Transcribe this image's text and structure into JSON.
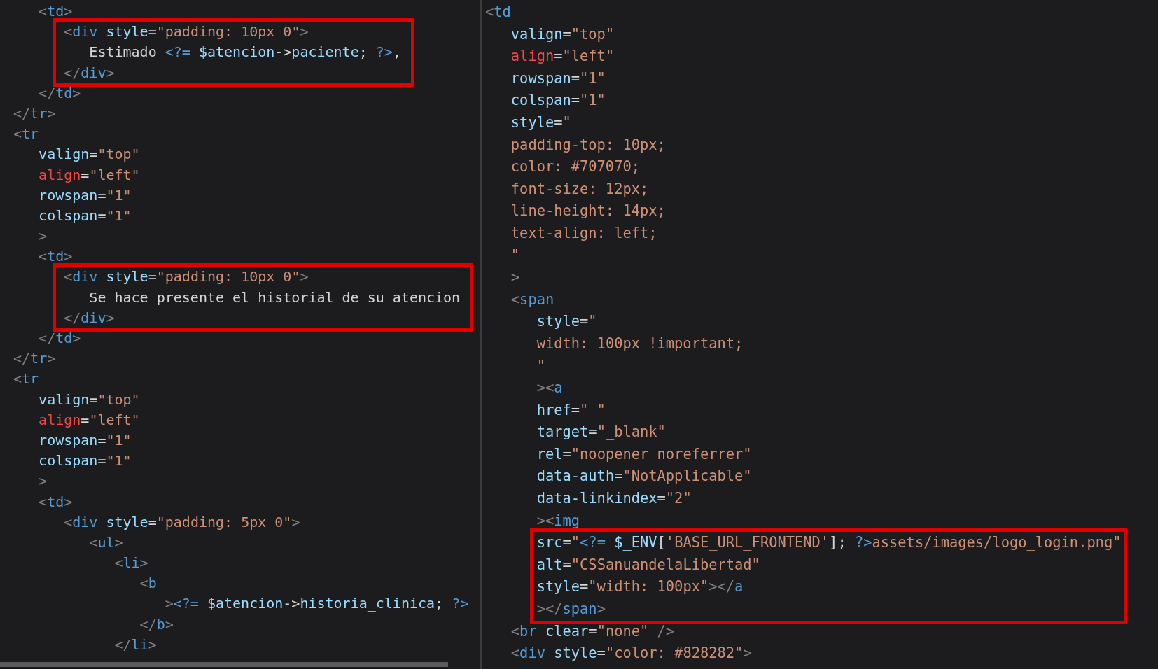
{
  "panes": [
    {
      "blocks": [
        {
          "highlighted": false,
          "lines": [
            {
              "tokens": [
                {
                  "kind": "punct",
                  "text": "   <"
                },
                {
                  "kind": "tag",
                  "text": "td"
                },
                {
                  "kind": "punct",
                  "text": ">"
                }
              ]
            }
          ]
        },
        {
          "highlighted": true,
          "lines": [
            {
              "tokens": [
                {
                  "kind": "punct",
                  "text": "      <"
                },
                {
                  "kind": "tag",
                  "text": "div "
                },
                {
                  "kind": "attr",
                  "text": "style"
                },
                {
                  "kind": "text",
                  "text": "="
                },
                {
                  "kind": "string",
                  "text": "\"padding: 10px 0\""
                },
                {
                  "kind": "punct",
                  "text": ">"
                }
              ]
            },
            {
              "tokens": [
                {
                  "kind": "text",
                  "text": "         Estimado "
                },
                {
                  "kind": "php",
                  "text": "<?= "
                },
                {
                  "kind": "var",
                  "text": "$atencion"
                },
                {
                  "kind": "text",
                  "text": "->"
                },
                {
                  "kind": "var",
                  "text": "paciente"
                },
                {
                  "kind": "text",
                  "text": "; "
                },
                {
                  "kind": "php",
                  "text": "?>"
                },
                {
                  "kind": "text",
                  "text": ","
                }
              ]
            },
            {
              "tokens": [
                {
                  "kind": "punct",
                  "text": "      </"
                },
                {
                  "kind": "tag",
                  "text": "div"
                },
                {
                  "kind": "punct",
                  "text": ">"
                }
              ]
            }
          ]
        },
        {
          "highlighted": false,
          "lines": [
            {
              "tokens": [
                {
                  "kind": "punct",
                  "text": "   </"
                },
                {
                  "kind": "tag",
                  "text": "td"
                },
                {
                  "kind": "punct",
                  "text": ">"
                }
              ]
            },
            {
              "tokens": [
                {
                  "kind": "punct",
                  "text": "</"
                },
                {
                  "kind": "tag",
                  "text": "tr"
                },
                {
                  "kind": "punct",
                  "text": ">"
                }
              ]
            },
            {
              "tokens": [
                {
                  "kind": "punct",
                  "text": "<"
                },
                {
                  "kind": "tag",
                  "text": "tr"
                }
              ]
            },
            {
              "tokens": [
                {
                  "kind": "attr",
                  "text": "   valign"
                },
                {
                  "kind": "text",
                  "text": "="
                },
                {
                  "kind": "string",
                  "text": "\"top\""
                }
              ]
            },
            {
              "tokens": [
                {
                  "kind": "attr_warn",
                  "text": "   align"
                },
                {
                  "kind": "text",
                  "text": "="
                },
                {
                  "kind": "string",
                  "text": "\"left\""
                }
              ]
            },
            {
              "tokens": [
                {
                  "kind": "attr",
                  "text": "   rowspan"
                },
                {
                  "kind": "text",
                  "text": "="
                },
                {
                  "kind": "string",
                  "text": "\"1\""
                }
              ]
            },
            {
              "tokens": [
                {
                  "kind": "attr",
                  "text": "   colspan"
                },
                {
                  "kind": "text",
                  "text": "="
                },
                {
                  "kind": "string",
                  "text": "\"1\""
                }
              ]
            },
            {
              "tokens": [
                {
                  "kind": "punct",
                  "text": "   >"
                }
              ]
            },
            {
              "tokens": [
                {
                  "kind": "punct",
                  "text": "   <"
                },
                {
                  "kind": "tag",
                  "text": "td"
                },
                {
                  "kind": "punct",
                  "text": ">"
                }
              ]
            }
          ]
        },
        {
          "highlighted": true,
          "lines": [
            {
              "tokens": [
                {
                  "kind": "punct",
                  "text": "      <"
                },
                {
                  "kind": "tag",
                  "text": "div "
                },
                {
                  "kind": "attr",
                  "text": "style"
                },
                {
                  "kind": "text",
                  "text": "="
                },
                {
                  "kind": "string",
                  "text": "\"padding: 10px 0\""
                },
                {
                  "kind": "punct",
                  "text": ">"
                }
              ]
            },
            {
              "tokens": [
                {
                  "kind": "text",
                  "text": "         Se hace presente el historial de su atencion"
                }
              ]
            },
            {
              "tokens": [
                {
                  "kind": "punct",
                  "text": "      </"
                },
                {
                  "kind": "tag",
                  "text": "div"
                },
                {
                  "kind": "punct",
                  "text": ">"
                }
              ]
            }
          ]
        },
        {
          "highlighted": false,
          "lines": [
            {
              "tokens": [
                {
                  "kind": "punct",
                  "text": "   </"
                },
                {
                  "kind": "tag",
                  "text": "td"
                },
                {
                  "kind": "punct",
                  "text": ">"
                }
              ]
            },
            {
              "tokens": [
                {
                  "kind": "punct",
                  "text": "</"
                },
                {
                  "kind": "tag",
                  "text": "tr"
                },
                {
                  "kind": "punct",
                  "text": ">"
                }
              ]
            },
            {
              "tokens": [
                {
                  "kind": "punct",
                  "text": "<"
                },
                {
                  "kind": "tag",
                  "text": "tr"
                }
              ]
            },
            {
              "tokens": [
                {
                  "kind": "attr",
                  "text": "   valign"
                },
                {
                  "kind": "text",
                  "text": "="
                },
                {
                  "kind": "string",
                  "text": "\"top\""
                }
              ]
            },
            {
              "tokens": [
                {
                  "kind": "attr_warn",
                  "text": "   align"
                },
                {
                  "kind": "text",
                  "text": "="
                },
                {
                  "kind": "string",
                  "text": "\"left\""
                }
              ]
            },
            {
              "tokens": [
                {
                  "kind": "attr",
                  "text": "   rowspan"
                },
                {
                  "kind": "text",
                  "text": "="
                },
                {
                  "kind": "string",
                  "text": "\"1\""
                }
              ]
            },
            {
              "tokens": [
                {
                  "kind": "attr",
                  "text": "   colspan"
                },
                {
                  "kind": "text",
                  "text": "="
                },
                {
                  "kind": "string",
                  "text": "\"1\""
                }
              ]
            },
            {
              "tokens": [
                {
                  "kind": "punct",
                  "text": "   >"
                }
              ]
            },
            {
              "tokens": [
                {
                  "kind": "punct",
                  "text": "   <"
                },
                {
                  "kind": "tag",
                  "text": "td"
                },
                {
                  "kind": "punct",
                  "text": ">"
                }
              ]
            },
            {
              "tokens": [
                {
                  "kind": "punct",
                  "text": "      <"
                },
                {
                  "kind": "tag",
                  "text": "div "
                },
                {
                  "kind": "attr",
                  "text": "style"
                },
                {
                  "kind": "text",
                  "text": "="
                },
                {
                  "kind": "string",
                  "text": "\"padding: 5px 0\""
                },
                {
                  "kind": "punct",
                  "text": ">"
                }
              ]
            },
            {
              "tokens": [
                {
                  "kind": "punct",
                  "text": "         <"
                },
                {
                  "kind": "tag",
                  "text": "ul"
                },
                {
                  "kind": "punct",
                  "text": ">"
                }
              ]
            },
            {
              "tokens": [
                {
                  "kind": "punct",
                  "text": "            <"
                },
                {
                  "kind": "tag",
                  "text": "li"
                },
                {
                  "kind": "punct",
                  "text": ">"
                }
              ]
            },
            {
              "tokens": [
                {
                  "kind": "punct",
                  "text": "               <"
                },
                {
                  "kind": "tag",
                  "text": "b"
                }
              ]
            },
            {
              "tokens": [
                {
                  "kind": "punct",
                  "text": "                  >"
                },
                {
                  "kind": "php",
                  "text": "<?= "
                },
                {
                  "kind": "var",
                  "text": "$atencion"
                },
                {
                  "kind": "text",
                  "text": "->"
                },
                {
                  "kind": "var",
                  "text": "historia_clinica"
                },
                {
                  "kind": "text",
                  "text": "; "
                },
                {
                  "kind": "php",
                  "text": "?>"
                }
              ]
            },
            {
              "tokens": [
                {
                  "kind": "punct",
                  "text": "               </"
                },
                {
                  "kind": "tag",
                  "text": "b"
                },
                {
                  "kind": "punct",
                  "text": ">"
                }
              ]
            },
            {
              "tokens": [
                {
                  "kind": "punct",
                  "text": "            </"
                },
                {
                  "kind": "tag",
                  "text": "li"
                },
                {
                  "kind": "punct",
                  "text": ">"
                }
              ]
            }
          ]
        }
      ]
    },
    {
      "blocks": [
        {
          "highlighted": false,
          "lines": [
            {
              "tokens": [
                {
                  "kind": "punct",
                  "text": "<"
                },
                {
                  "kind": "tag",
                  "text": "td"
                }
              ]
            },
            {
              "tokens": [
                {
                  "kind": "attr",
                  "text": "   valign"
                },
                {
                  "kind": "text",
                  "text": "="
                },
                {
                  "kind": "string",
                  "text": "\"top\""
                }
              ]
            },
            {
              "tokens": [
                {
                  "kind": "attr_warn",
                  "text": "   align"
                },
                {
                  "kind": "text",
                  "text": "="
                },
                {
                  "kind": "string",
                  "text": "\"left\""
                }
              ]
            },
            {
              "tokens": [
                {
                  "kind": "attr",
                  "text": "   rowspan"
                },
                {
                  "kind": "text",
                  "text": "="
                },
                {
                  "kind": "string",
                  "text": "\"1\""
                }
              ]
            },
            {
              "tokens": [
                {
                  "kind": "attr",
                  "text": "   colspan"
                },
                {
                  "kind": "text",
                  "text": "="
                },
                {
                  "kind": "string",
                  "text": "\"1\""
                }
              ]
            },
            {
              "tokens": [
                {
                  "kind": "attr",
                  "text": "   style"
                },
                {
                  "kind": "text",
                  "text": "="
                },
                {
                  "kind": "string",
                  "text": "\""
                }
              ]
            },
            {
              "tokens": [
                {
                  "kind": "string",
                  "text": "   padding-top: 10px;"
                }
              ]
            },
            {
              "tokens": [
                {
                  "kind": "string",
                  "text": "   color: #707070;"
                }
              ]
            },
            {
              "tokens": [
                {
                  "kind": "string",
                  "text": "   font-size: 12px;"
                }
              ]
            },
            {
              "tokens": [
                {
                  "kind": "string",
                  "text": "   line-height: 14px;"
                }
              ]
            },
            {
              "tokens": [
                {
                  "kind": "string",
                  "text": "   text-align: left;"
                }
              ]
            },
            {
              "tokens": [
                {
                  "kind": "string",
                  "text": "   \""
                }
              ]
            },
            {
              "tokens": [
                {
                  "kind": "punct",
                  "text": "   >"
                }
              ]
            },
            {
              "tokens": [
                {
                  "kind": "punct",
                  "text": "   <"
                },
                {
                  "kind": "tag",
                  "text": "span"
                }
              ]
            },
            {
              "tokens": [
                {
                  "kind": "attr",
                  "text": "      style"
                },
                {
                  "kind": "text",
                  "text": "="
                },
                {
                  "kind": "string",
                  "text": "\""
                }
              ]
            },
            {
              "tokens": [
                {
                  "kind": "string",
                  "text": "      width: 100px !important;"
                }
              ]
            },
            {
              "tokens": [
                {
                  "kind": "string",
                  "text": "      \""
                }
              ]
            },
            {
              "tokens": [
                {
                  "kind": "punct",
                  "text": "      ><"
                },
                {
                  "kind": "tag",
                  "text": "a"
                }
              ]
            },
            {
              "tokens": [
                {
                  "kind": "attr",
                  "text": "      href"
                },
                {
                  "kind": "text",
                  "text": "="
                },
                {
                  "kind": "string",
                  "text": "\" \""
                }
              ]
            },
            {
              "tokens": [
                {
                  "kind": "attr",
                  "text": "      target"
                },
                {
                  "kind": "text",
                  "text": "="
                },
                {
                  "kind": "string",
                  "text": "\"_blank\""
                }
              ]
            },
            {
              "tokens": [
                {
                  "kind": "attr",
                  "text": "      rel"
                },
                {
                  "kind": "text",
                  "text": "="
                },
                {
                  "kind": "string",
                  "text": "\"noopener noreferrer\""
                }
              ]
            },
            {
              "tokens": [
                {
                  "kind": "attr",
                  "text": "      data-auth"
                },
                {
                  "kind": "text",
                  "text": "="
                },
                {
                  "kind": "string",
                  "text": "\"NotApplicable\""
                }
              ]
            },
            {
              "tokens": [
                {
                  "kind": "attr",
                  "text": "      data-linkindex"
                },
                {
                  "kind": "text",
                  "text": "="
                },
                {
                  "kind": "string",
                  "text": "\"2\""
                }
              ]
            },
            {
              "tokens": [
                {
                  "kind": "punct",
                  "text": "      ><"
                },
                {
                  "kind": "tag",
                  "text": "img"
                }
              ]
            }
          ]
        },
        {
          "highlighted": true,
          "lines": [
            {
              "tokens": [
                {
                  "kind": "attr",
                  "text": "      src"
                },
                {
                  "kind": "text",
                  "text": "="
                },
                {
                  "kind": "string",
                  "text": "\""
                },
                {
                  "kind": "php",
                  "text": "<?= "
                },
                {
                  "kind": "var",
                  "text": "$_ENV"
                },
                {
                  "kind": "text",
                  "text": "["
                },
                {
                  "kind": "string",
                  "text": "'BASE_URL_FRONTEND'"
                },
                {
                  "kind": "text",
                  "text": "]; "
                },
                {
                  "kind": "php",
                  "text": "?>"
                },
                {
                  "kind": "string",
                  "text": "assets/images/logo_login.png\""
                }
              ]
            },
            {
              "tokens": [
                {
                  "kind": "attr",
                  "text": "      alt"
                },
                {
                  "kind": "text",
                  "text": "="
                },
                {
                  "kind": "string",
                  "text": "\"CSSanuandelaLibertad\""
                }
              ]
            },
            {
              "tokens": [
                {
                  "kind": "attr",
                  "text": "      style"
                },
                {
                  "kind": "text",
                  "text": "="
                },
                {
                  "kind": "string",
                  "text": "\"width: 100px\""
                },
                {
                  "kind": "punct",
                  "text": "></"
                },
                {
                  "kind": "tag",
                  "text": "a"
                }
              ]
            },
            {
              "tokens": [
                {
                  "kind": "punct",
                  "text": "      ></"
                },
                {
                  "kind": "tag",
                  "text": "span"
                },
                {
                  "kind": "punct",
                  "text": ">"
                }
              ]
            }
          ]
        },
        {
          "highlighted": false,
          "lines": [
            {
              "tokens": [
                {
                  "kind": "punct",
                  "text": "   <"
                },
                {
                  "kind": "tag",
                  "text": "br "
                },
                {
                  "kind": "attr",
                  "text": "clear"
                },
                {
                  "kind": "text",
                  "text": "="
                },
                {
                  "kind": "string",
                  "text": "\"none\" "
                },
                {
                  "kind": "punct",
                  "text": "/>"
                }
              ]
            },
            {
              "tokens": [
                {
                  "kind": "punct",
                  "text": "   <"
                },
                {
                  "kind": "tag",
                  "text": "div "
                },
                {
                  "kind": "attr",
                  "text": "style"
                },
                {
                  "kind": "text",
                  "text": "="
                },
                {
                  "kind": "string",
                  "text": "\"color: #828282\""
                },
                {
                  "kind": "punct",
                  "text": ">"
                }
              ]
            }
          ]
        }
      ]
    }
  ]
}
